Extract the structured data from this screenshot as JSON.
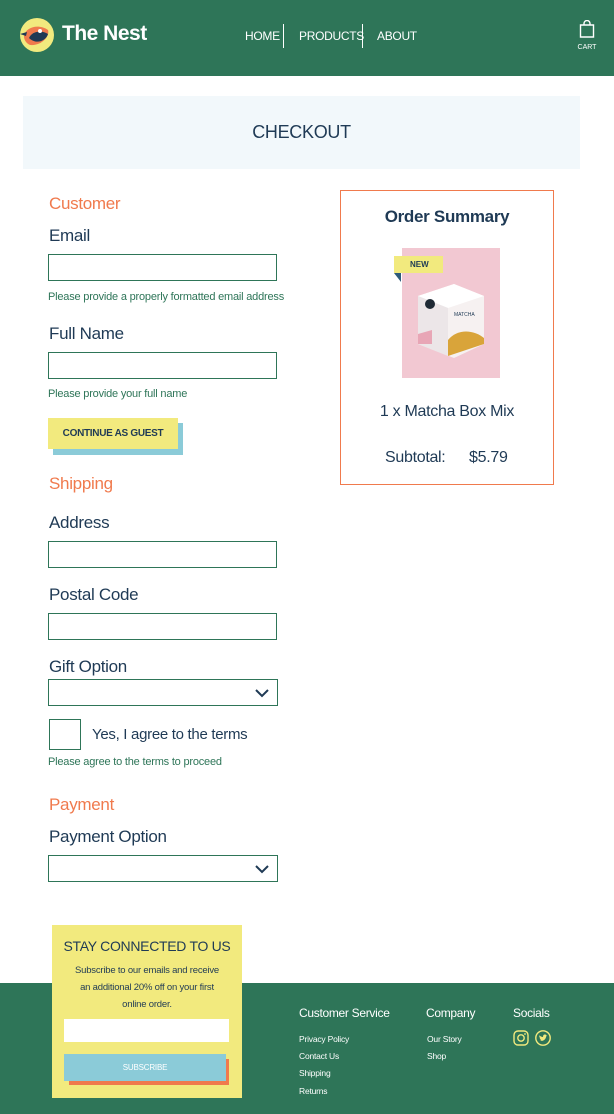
{
  "header": {
    "brand": "The Nest",
    "nav": [
      "HOME",
      "PRODUCTS",
      "ABOUT"
    ],
    "cart_label": "CART",
    "colors": {
      "bar": "#2e7558",
      "logo_orange": "#f07a4d",
      "logo_yellow": "#f2ea7e",
      "logo_navy": "#1f3a55"
    },
    "icons": [
      "bird-logo-icon",
      "shopping-bag-icon"
    ]
  },
  "banner": {
    "title": "CHECKOUT"
  },
  "form": {
    "customer_title": "Customer",
    "email_label": "Email",
    "email_hint": "Please provide a properly formatted email address",
    "name_label": "Full Name",
    "name_hint": "Please provide your full name",
    "continue_button": "CONTINUE AS GUEST",
    "shipping_title": "Shipping",
    "address_label": "Address",
    "postal_label": "Postal Code",
    "gift_label": "Gift Option",
    "agree_label": "Yes, I agree to the terms",
    "agree_hint": "Please agree to the terms  to proceed",
    "payment_title": "Payment",
    "payment_label": "Payment Option"
  },
  "summary": {
    "title": "Order Summary",
    "badge": "NEW",
    "product_text": "MATCHA",
    "item": "1 x Matcha Box Mix",
    "subtotal_label": "Subtotal:",
    "subtotal_value": "$5.79"
  },
  "newsletter": {
    "title": "STAY CONNECTED TO US",
    "text": "Subscribe to our emails and receive an additional 20% off on your first online order.",
    "button": "SUBSCRIBE"
  },
  "footer": {
    "customer_service": {
      "title": "Customer Service",
      "links": [
        "Privacy Policy",
        "Contact Us",
        "Shipping",
        "Returns"
      ]
    },
    "company": {
      "title": "Company",
      "links": [
        "Our Story",
        "Shop"
      ]
    },
    "socials": {
      "title": "Socials",
      "icons": [
        "instagram-icon",
        "twitter-icon"
      ]
    }
  },
  "colors": {
    "accent": "#f07a4d",
    "green": "#2e7558",
    "yellow": "#f2ea7e",
    "blue": "#8bcbd8",
    "navy": "#1f3a55"
  }
}
